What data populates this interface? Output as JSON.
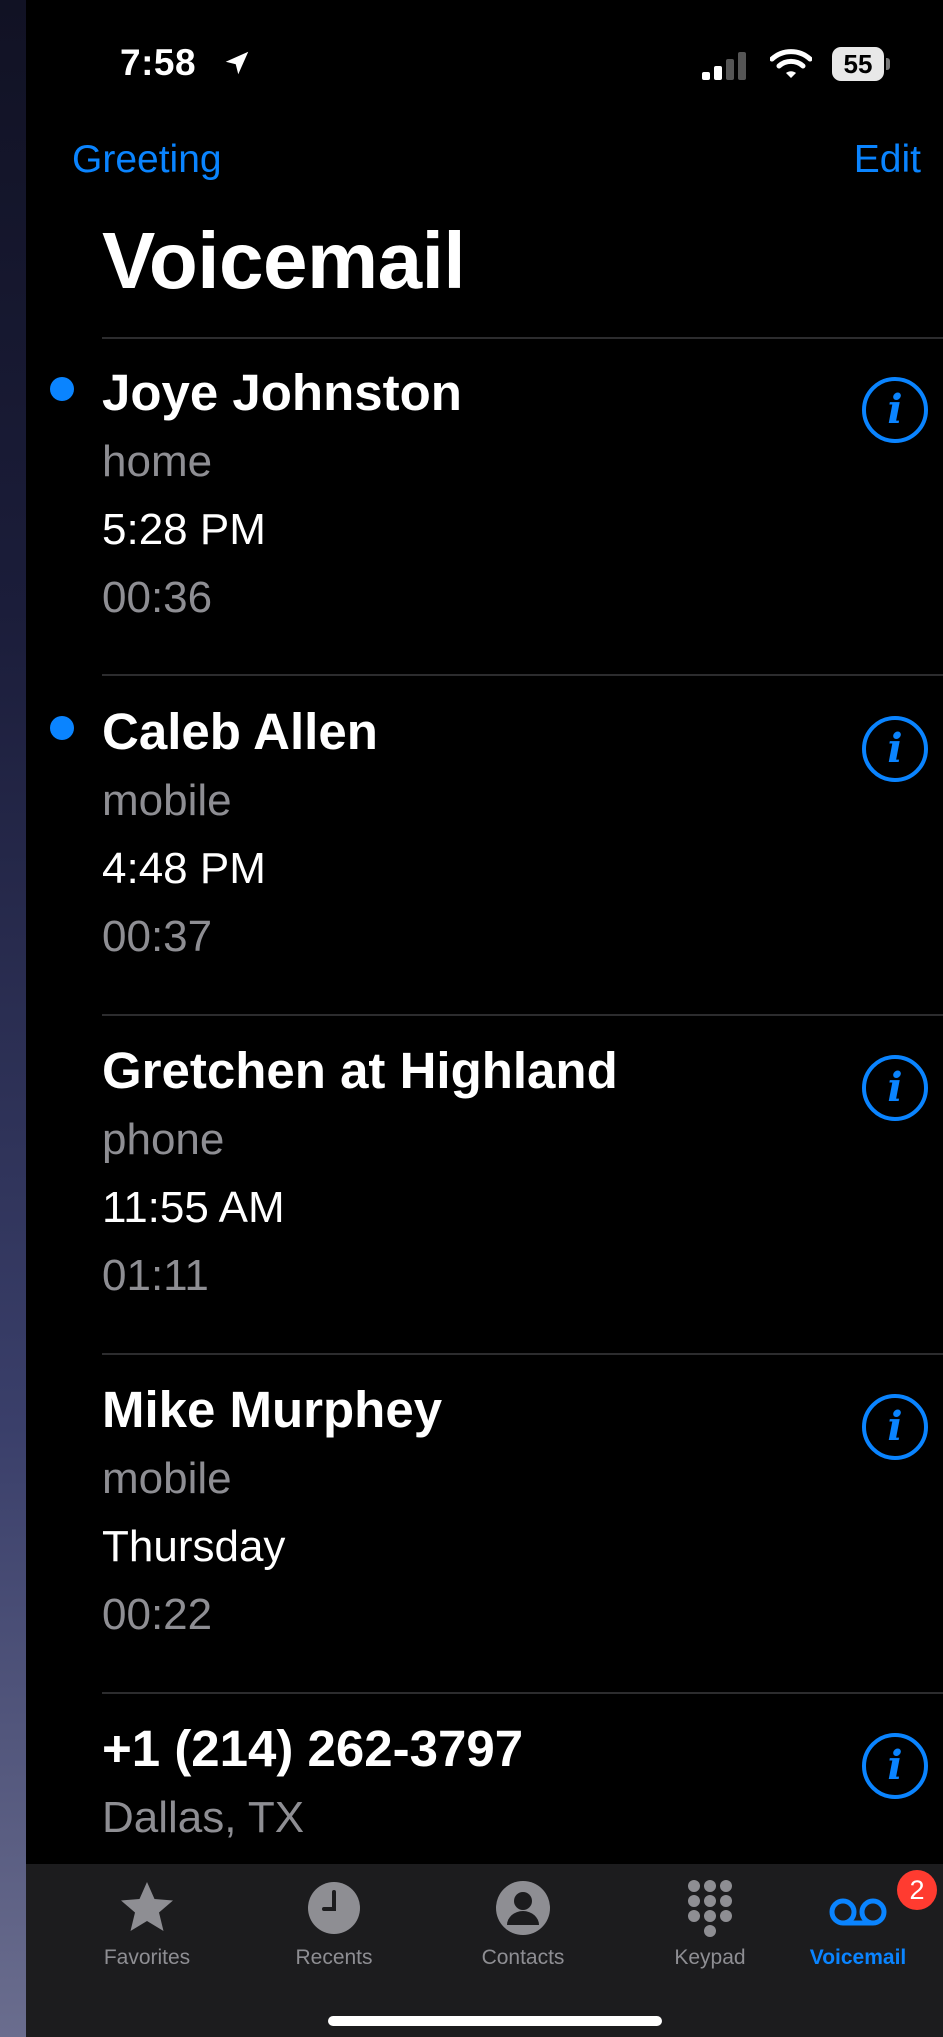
{
  "status": {
    "time": "7:58",
    "battery": "55"
  },
  "nav": {
    "greeting_label": "Greeting",
    "edit_label": "Edit"
  },
  "title": "Voicemail",
  "voicemails": [
    {
      "name": "Joye Johnston",
      "label": "home",
      "time": "5:28 PM",
      "duration": "00:36",
      "unread": true
    },
    {
      "name": "Caleb Allen",
      "label": "mobile",
      "time": "4:48 PM",
      "duration": "00:37",
      "unread": true
    },
    {
      "name": "Gretchen at Highland",
      "label": "phone",
      "time": "11:55 AM",
      "duration": "01:11",
      "unread": false
    },
    {
      "name": "Mike Murphey",
      "label": "mobile",
      "time": "Thursday",
      "duration": "00:22",
      "unread": false
    },
    {
      "name": "+1 (214) 262-3797",
      "label": "Dallas, TX",
      "time": "",
      "duration": "",
      "unread": false
    }
  ],
  "tabs": [
    {
      "label": "Favorites",
      "icon": "star-icon",
      "active": false
    },
    {
      "label": "Recents",
      "icon": "clock-icon",
      "active": false
    },
    {
      "label": "Contacts",
      "icon": "person-icon",
      "active": false
    },
    {
      "label": "Keypad",
      "icon": "keypad-icon",
      "active": false
    },
    {
      "label": "Voicemail",
      "icon": "voicemail-icon",
      "active": true,
      "badge": "2"
    }
  ],
  "colors": {
    "accent": "#0a84ff",
    "secondary_text": "#8e8e93",
    "badge": "#ff3b30",
    "background": "#000000"
  }
}
